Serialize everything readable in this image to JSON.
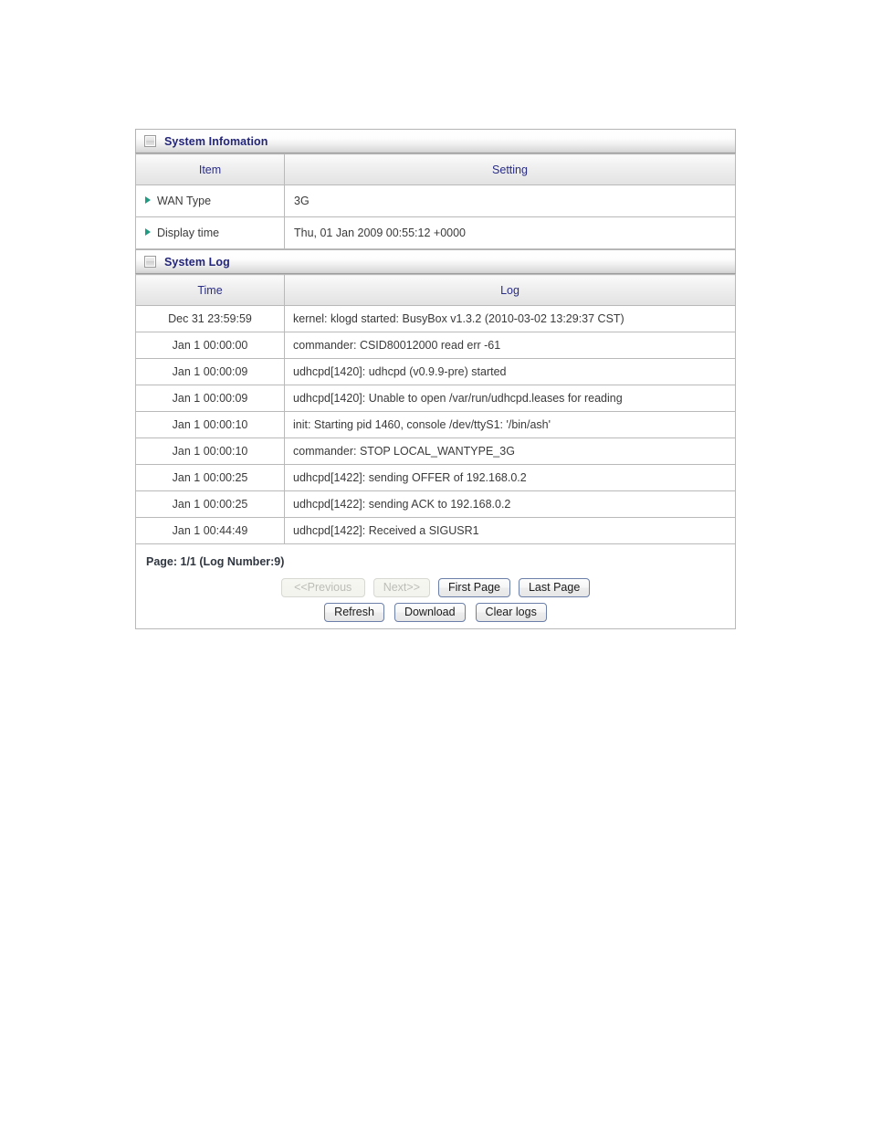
{
  "system_information": {
    "section_title": "System Infomation",
    "icon": "window-box-icon",
    "columns": {
      "item": "Item",
      "setting": "Setting"
    },
    "rows": [
      {
        "item": "WAN Type",
        "setting": "3G"
      },
      {
        "item": "Display time",
        "setting": "Thu, 01 Jan 2009 00:55:12 +0000"
      }
    ]
  },
  "system_log": {
    "section_title": "System Log",
    "icon": "window-box-icon",
    "columns": {
      "time": "Time",
      "log": "Log"
    },
    "entries": [
      {
        "time": "Dec 31 23:59:59",
        "log": "kernel: klogd started: BusyBox v1.3.2 (2010-03-02 13:29:37 CST)"
      },
      {
        "time": "Jan 1 00:00:00",
        "log": "commander: CSID80012000 read err -61"
      },
      {
        "time": "Jan 1 00:00:09",
        "log": "udhcpd[1420]: udhcpd (v0.9.9-pre) started"
      },
      {
        "time": "Jan 1 00:00:09",
        "log": "udhcpd[1420]: Unable to open /var/run/udhcpd.leases for reading"
      },
      {
        "time": "Jan 1 00:00:10",
        "log": "init: Starting pid 1460, console /dev/ttyS1: '/bin/ash'"
      },
      {
        "time": "Jan 1 00:00:10",
        "log": "commander: STOP LOCAL_WANTYPE_3G"
      },
      {
        "time": "Jan 1 00:00:25",
        "log": "udhcpd[1422]: sending OFFER of 192.168.0.2"
      },
      {
        "time": "Jan 1 00:00:25",
        "log": "udhcpd[1422]: sending ACK to 192.168.0.2"
      },
      {
        "time": "Jan 1 00:44:49",
        "log": "udhcpd[1422]: Received a SIGUSR1"
      }
    ],
    "pager": {
      "status": "Page: 1/1 (Log Number:9)",
      "previous": "<<Previous",
      "next": "Next>>",
      "first_page": "First Page",
      "last_page": "Last Page",
      "refresh": "Refresh",
      "download": "Download",
      "clear_logs": "Clear logs"
    }
  },
  "colors": {
    "title_text": "#23257a",
    "header_text": "#2a2d85",
    "bullet": "#1e9b82",
    "border": "#b9b9b9",
    "button_border": "#6b7fa8",
    "disabled_text": "#bdbdb8"
  }
}
